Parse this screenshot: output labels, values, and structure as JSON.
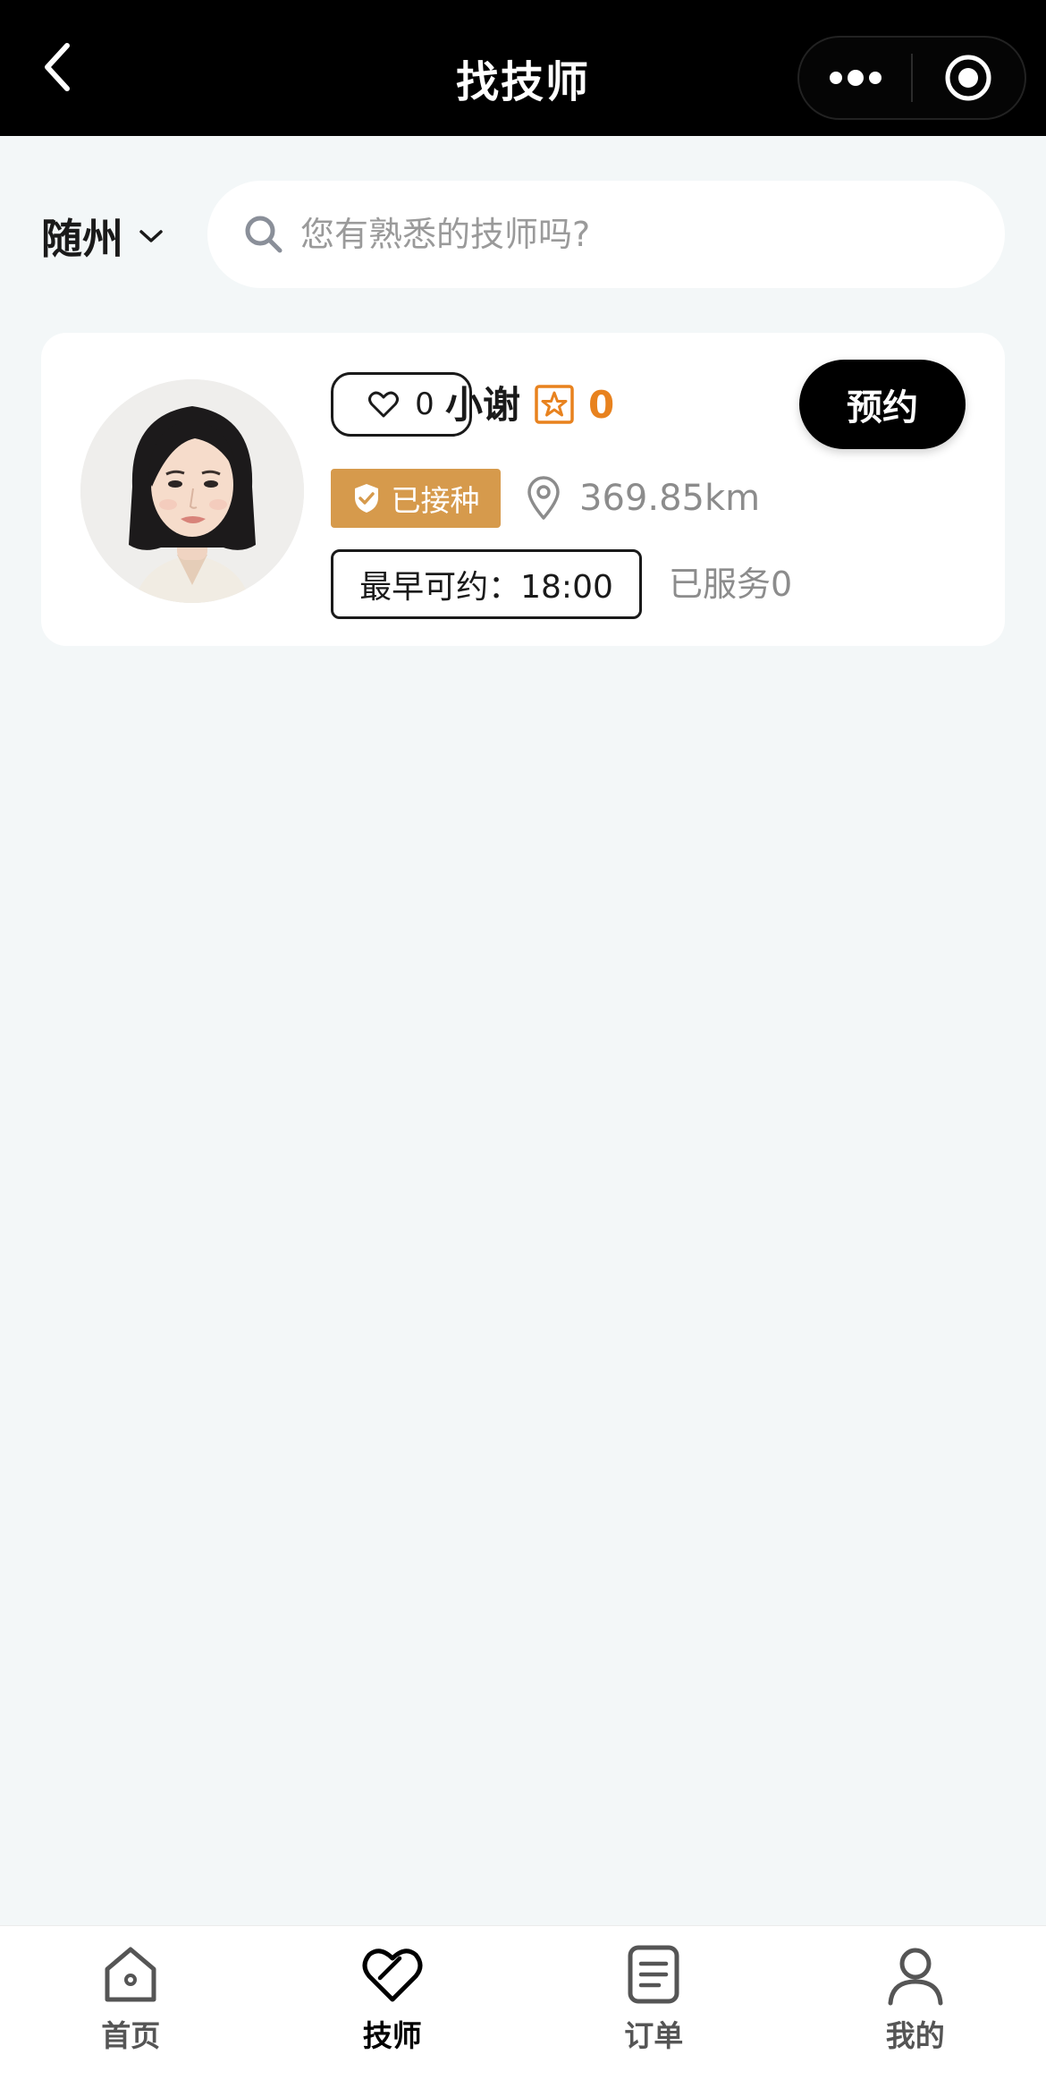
{
  "header": {
    "title": "找技师",
    "back_icon": "chevron-left-icon",
    "more_icon": "more-dots-icon",
    "close_icon": "target-circle-icon"
  },
  "search": {
    "city": "随州",
    "placeholder": "您有熟悉的技师吗?"
  },
  "technicians": [
    {
      "likes": "0",
      "name": "小谢",
      "rating": "0",
      "book_label": "预约",
      "vaccinated_label": "已接种",
      "distance": "369.85km",
      "earliest_label": "最早可约：18:00",
      "served_label": "已服务0"
    }
  ],
  "tabbar": {
    "items": [
      {
        "label": "首页",
        "icon": "home-icon",
        "active": false
      },
      {
        "label": "技师",
        "icon": "heart-icon",
        "active": true
      },
      {
        "label": "订单",
        "icon": "order-list-icon",
        "active": false
      },
      {
        "label": "我的",
        "icon": "user-icon",
        "active": false
      }
    ]
  },
  "colors": {
    "header_bg": "#000000",
    "page_bg": "#f3f7f8",
    "accent_orange": "#e8821e",
    "badge_gold": "#d69a4c"
  }
}
